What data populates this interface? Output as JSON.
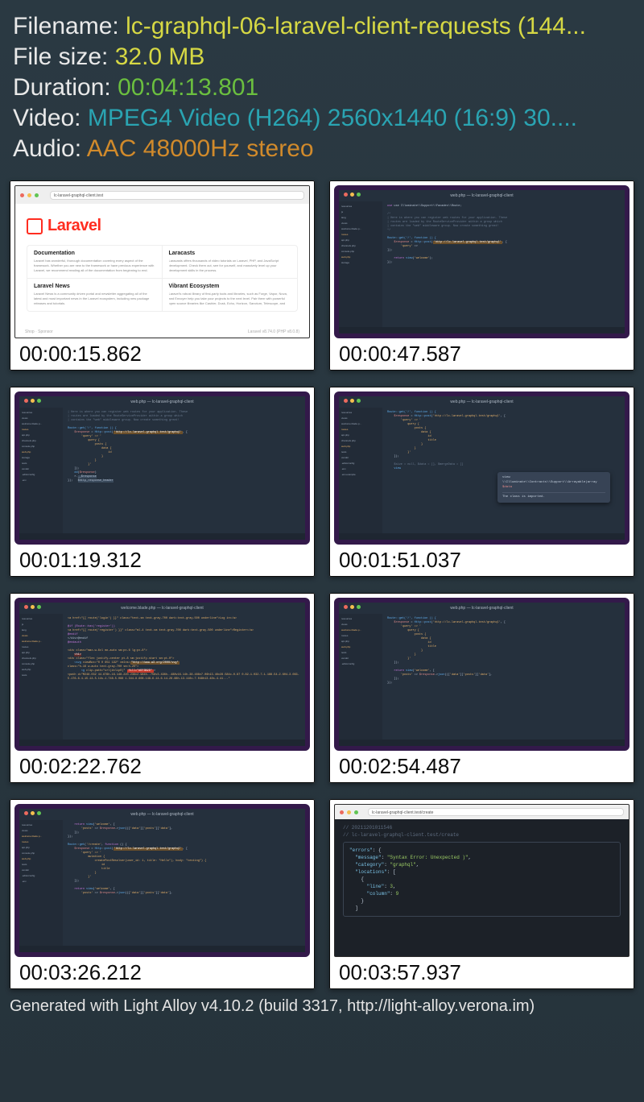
{
  "meta": {
    "labels": {
      "filename": "Filename:",
      "filesize": "File size:",
      "duration": "Duration:",
      "video": "Video:",
      "audio": "Audio:"
    },
    "filename": "lc-graphql-06-laravel-client-requests (144...",
    "filesize": "32.0 MB",
    "duration": "00:04:13.801",
    "video": "MPEG4 Video (H264) 2560x1440 (16:9) 30....",
    "audio": "AAC 48000Hz stereo"
  },
  "thumbs": {
    "t1": {
      "time": "00:00:15.862"
    },
    "t2": {
      "time": "00:00:47.587"
    },
    "t3": {
      "time": "00:01:19.312"
    },
    "t4": {
      "time": "00:01:51.037"
    },
    "t5": {
      "time": "00:02:22.762"
    },
    "t6": {
      "time": "00:02:54.487"
    },
    "t7": {
      "time": "00:03:26.212"
    },
    "t8": {
      "time": "00:03:57.937"
    }
  },
  "laravel": {
    "addr": "lc-laravel-graphql-client.test",
    "brand": "Laravel",
    "cards": {
      "docs": {
        "title": "Documentation",
        "sub": "Laravel has wonderful, thorough documentation covering every aspect of the framework. Whether you are new to the framework or have previous experience with Laravel, we recommend reading all of the documentation from beginning to end."
      },
      "casts": {
        "title": "Laracasts",
        "sub": "Laracasts offers thousands of video tutorials on Laravel, PHP, and JavaScript development. Check them out, see for yourself, and massively level up your development skills in the process."
      },
      "news": {
        "title": "Laravel News",
        "sub": "Laravel News is a community driven portal and newsletter aggregating all of the latest and most important news in the Laravel ecosystem, including new package releases and tutorials."
      },
      "eco": {
        "title": "Vibrant Ecosystem",
        "sub": "Laravel's robust library of first-party tools and libraries, such as Forge, Vapor, Nova, and Envoyer help you take your projects to the next level. Pair them with powerful open source libraries like Cashier, Dusk, Echo, Horizon, Sanctum, Telescope, and more."
      }
    },
    "footer_left": "Shop · Sponsor",
    "footer_right": "Laravel v8.74.0 (PHP v8.0.8)"
  },
  "ide": {
    "title": "web.php — lc-laravel-graphql-client",
    "title_welcome": "welcome.blade.php — lc-laravel-graphql-client",
    "sidebar": [
      "resources",
      "js",
      "lang",
      "views",
      "welcome.blade.p...",
      "routes",
      "api.php",
      "channels.php",
      "console.php",
      "web.php",
      "storage",
      "tests",
      "vendor",
      ".editorconfig",
      ".env",
      ".env.example"
    ],
    "code2": {
      "l1": "use Illuminate\\\\Support\\\\Facades\\\\Route;",
      "l2": "/*",
      "l3": "| Here is where you can register web routes for your application. These",
      "l4": "| routes are loaded by the RouteServiceProvider within a group which",
      "l5": "| contains the \"web\" middleware group. Now create something great!",
      "l6": "*/",
      "l7": "Route::get('/', function () {",
      "l8": "    $response = Http::post('http://lc-laravel-graphql.test/graphql', [",
      "l9": "        'query' =>",
      "l10": "    ]);",
      "l11": "    return view('welcome');",
      "l12": "});"
    },
    "code3": {
      "l1": "Route::get('/', function () {",
      "l2": "    $response = Http::post('http://lc-laravel-graphql.test/graphql', [",
      "l3": "        'query' => '",
      "l4": "            query {",
      "l5": "                posts {",
      "l6": "                    data {",
      "l7": "                        id",
      "l8": "                    }",
      "l9": "                }",
      "l10": "            }",
      "l11": "        '",
      "l12": "    ]);",
      "l13": "    dd($response)",
      "l14": "    r.__$response",
      "l15": "});   $http_response_header"
    },
    "code4": {
      "l1": "Route::get('/', function () {",
      "l2": "    $response = Http::post('http://lc-laravel-graphql.test/graphql', [",
      "l3": "        'query' => '",
      "l4": "            query {",
      "l5": "                posts {",
      "l6": "                    data {",
      "l7": "                        id",
      "l8": "                        title",
      "l9": "                    }",
      "l10": "                }",
      "l11": "            }'",
      "l12": "    ]);",
      "l13": "",
      "l14": "    $size = null; $data = []; $mergeData = [];",
      "l15": "    view \\\\Illuminate\\\\Contracts\\\\Support\\\\Arrayable|array",
      "l16": "         $data",
      "dd_title": "The class is imported."
    },
    "code5": {
      "l1": "<a href=\"{{ route('login') }}\" class=\"text-sm text-gray-700 dark:text-gray-500 underline\">Log in</a>",
      "l2": "@if (Route::has('register'))",
      "l3": "    <a href=\"{{ route('register') }}\" class=\"ml-4 text-sm text-gray-700 dark:text-gray-500 underline\">Register</a>",
      "l4": "@endif",
      "l5": "</div>@endif",
      "l6": "@endauth",
      "l7": "<div class=\"max-w-6xl mx-auto sm:px-6 lg:px-8\">",
      "l8": "<h1>",
      "l9": "<div class=\"flex justify-center pt-8 sm:justify-start sm:pt-0\">",
      "l10": " <svg viewBox=\"0 0 651 192\" fill=\"none\" xmlns=\"http://www.w3.org/2000/svg\"",
      "l11": "  class=\"h-16 w-auto text-gray-700 sm:h-20\">",
      "l12": "   <g clip-path=\"url(#clip0)\" fill=\"#EF3B2D\">",
      "l13": "    <path d=\"M248.032 44.676h-16.148-220.236v2.964h-.756v3.496h-.488v16.14h-38.488v7.06h13.46v28.584c-0.87 0.82-1.032.7-1.188.54-2.604-3.083-5.176-6.4-15.14-5.14s-1.748-5.088 1.344-8.608.148-6.14-6.14-28.88h-13.116v-7.048h13.48s-4.41...\""
    },
    "code6": {
      "l1": "Route::get('/', function () {",
      "l2": "    $response = Http::post('http://lc-laravel-graphql.test/graphql', [",
      "l3": "        'query' => '",
      "l4": "            query {",
      "l5": "                posts {",
      "l6": "                    data {",
      "l7": "                        id",
      "l8": "                        title",
      "l9": "                    }",
      "l10": "                }",
      "l11": "            }'",
      "l12": "    ]);",
      "l13": "    return view('welcome', [",
      "l14": "        'posts' => $response->json()['data']['posts']['data'],",
      "l15": "    ]);",
      "l16": "});"
    },
    "code7": {
      "l1": "    return view('welcome', [",
      "l2": "        'posts' => $response->json()['data']['posts']['data'],",
      "l3": "    ]);",
      "l4": "});",
      "l5": "Route::get('/create', function () {",
      "l6": "    $response = Http::post('http://lc-laravel-graphql.test/graphql', [",
      "l7": "        'query' => '",
      "l8": "            mutation {",
      "l9": "                createPostResolver(user_id: 1, title: \"Hello\"), body: \"testing\") {",
      "l10": "                    id",
      "l11": "                    title",
      "l12": "                }",
      "l13": "            }'",
      "l14": "    ]);",
      "l15": "    return view('welcome', [",
      "l16": "        'posts' => $response->json()['data']['posts']['data'],"
    },
    "code8": {
      "addr": "lc-laravel-graphql-client.test/create",
      "header": "// 20211201011546",
      "url": "// lc-laravel-graphql-client.test/create",
      "l1": "\"errors\": {",
      "l2": "  \"message\": \"Syntax Error: Unexpected )\",",
      "l3": "  \"category\": \"graphql\",",
      "l4": "  \"locations\": [",
      "l5": "    {",
      "l6": "      \"line\": 3,",
      "l7": "      \"column\": 9",
      "l8": "    }",
      "l9": "  ]"
    }
  },
  "footer": "Generated with Light Alloy v4.10.2 (build 3317, http://light-alloy.verona.im)"
}
